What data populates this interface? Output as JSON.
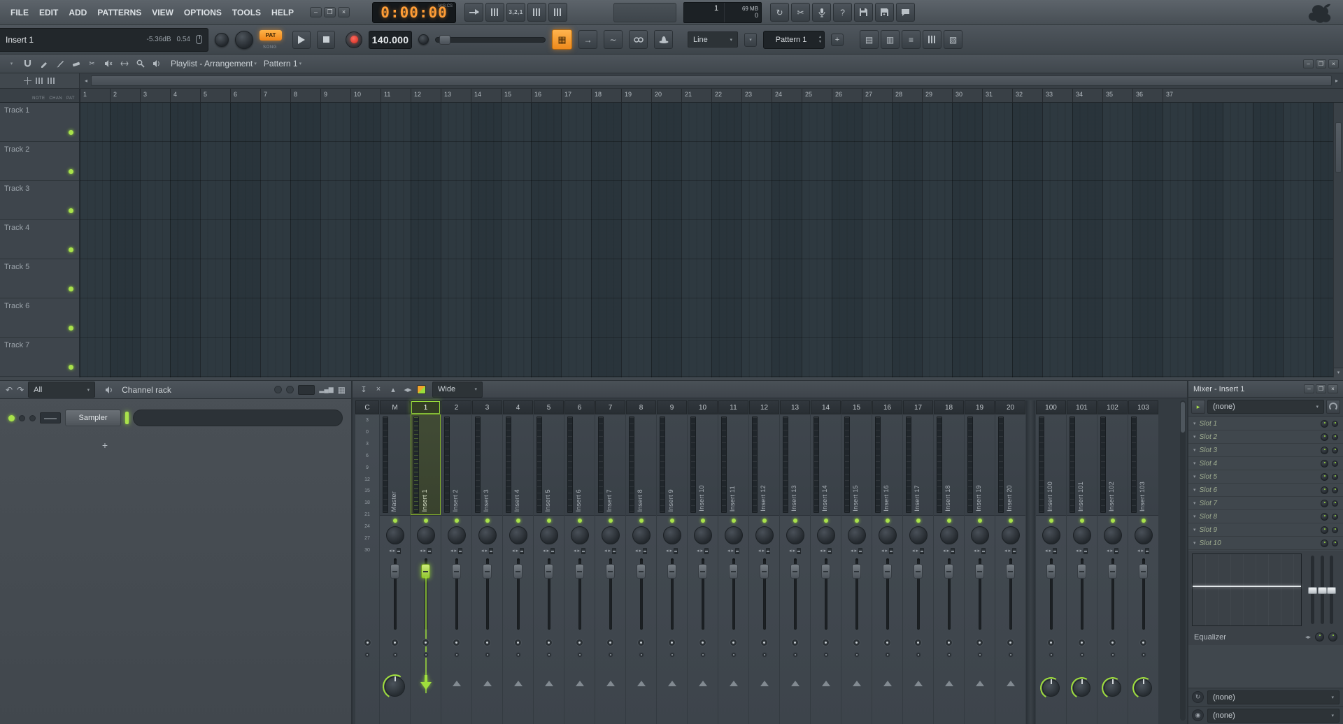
{
  "menubar": {
    "items": [
      "FILE",
      "EDIT",
      "ADD",
      "PATTERNS",
      "VIEW",
      "OPTIONS",
      "TOOLS",
      "HELP"
    ]
  },
  "toolbar": {
    "time": {
      "value": "0:00:00",
      "format": "M:S:CS"
    },
    "countdown_label": "3,2,1",
    "stats": {
      "pattern_count": "1",
      "memory": "69 MB",
      "counter": "0"
    },
    "help_label": "?"
  },
  "transport": {
    "hint_name": "Insert 1",
    "hint_value": "-5.36dB",
    "hint_value2": "0.54",
    "pat": "PAT",
    "song": "SONG",
    "tempo": "140.000",
    "snap": "Line",
    "pattern": "Pattern 1",
    "add": "+"
  },
  "playlist": {
    "title": "Playlist - Arrangement",
    "pattern": "Pattern 1",
    "col_labels": [
      "NOTE",
      "CHAN",
      "PAT"
    ],
    "bars": [
      1,
      2,
      3,
      4,
      5,
      6,
      7,
      8,
      9,
      10,
      11,
      12,
      13,
      14,
      15,
      16,
      17,
      18,
      19,
      20,
      21,
      22,
      23,
      24,
      25,
      26,
      27,
      28,
      29,
      30,
      31,
      32,
      33,
      34,
      35,
      36,
      37
    ],
    "tracks": [
      "Track 1",
      "Track 2",
      "Track 3",
      "Track 4",
      "Track 5",
      "Track 6",
      "Track 7"
    ]
  },
  "channel_rack": {
    "filter": "All",
    "title": "Channel rack",
    "channels": [
      "Sampler"
    ],
    "add": "+"
  },
  "mixer": {
    "view": "Wide",
    "db_scale": [
      "3",
      "0",
      "3",
      "6",
      "9",
      "12",
      "15",
      "18",
      "21",
      "24",
      "27",
      "30"
    ],
    "strips": [
      {
        "num": "C",
        "name": "",
        "type": "current"
      },
      {
        "num": "M",
        "name": "Master",
        "type": "master"
      },
      {
        "num": "1",
        "name": "Insert 1",
        "type": "insert",
        "selected": true
      },
      {
        "num": "2",
        "name": "Insert 2",
        "type": "insert"
      },
      {
        "num": "3",
        "name": "Insert 3",
        "type": "insert"
      },
      {
        "num": "4",
        "name": "Insert 4",
        "type": "insert"
      },
      {
        "num": "5",
        "name": "Insert 5",
        "type": "insert"
      },
      {
        "num": "6",
        "name": "Insert 6",
        "type": "insert"
      },
      {
        "num": "7",
        "name": "Insert 7",
        "type": "insert"
      },
      {
        "num": "8",
        "name": "Insert 8",
        "type": "insert"
      },
      {
        "num": "9",
        "name": "Insert 9",
        "type": "insert"
      },
      {
        "num": "10",
        "name": "Insert 10",
        "type": "insert"
      },
      {
        "num": "11",
        "name": "Insert 11",
        "type": "insert"
      },
      {
        "num": "12",
        "name": "Insert 12",
        "type": "insert"
      },
      {
        "num": "13",
        "name": "Insert 13",
        "type": "insert"
      },
      {
        "num": "14",
        "name": "Insert 14",
        "type": "insert"
      },
      {
        "num": "15",
        "name": "Insert 15",
        "type": "insert"
      },
      {
        "num": "16",
        "name": "Insert 16",
        "type": "insert"
      },
      {
        "num": "17",
        "name": "Insert 17",
        "type": "insert"
      },
      {
        "num": "18",
        "name": "Insert 18",
        "type": "insert"
      },
      {
        "num": "19",
        "name": "Insert 19",
        "type": "insert"
      },
      {
        "num": "20",
        "name": "Insert 20",
        "type": "insert"
      },
      {
        "num": "100",
        "name": "Insert 100",
        "type": "send"
      },
      {
        "num": "101",
        "name": "Insert 101",
        "type": "send"
      },
      {
        "num": "102",
        "name": "Insert 102",
        "type": "send"
      },
      {
        "num": "103",
        "name": "Insert 103",
        "type": "send"
      }
    ]
  },
  "mixer_props": {
    "title": "Mixer - Insert 1",
    "preset": "(none)",
    "slots": [
      "Slot 1",
      "Slot 2",
      "Slot 3",
      "Slot 4",
      "Slot 5",
      "Slot 6",
      "Slot 7",
      "Slot 8",
      "Slot 9",
      "Slot 10"
    ],
    "equalizer": "Equalizer",
    "input": "(none)",
    "output": "(none)"
  }
}
